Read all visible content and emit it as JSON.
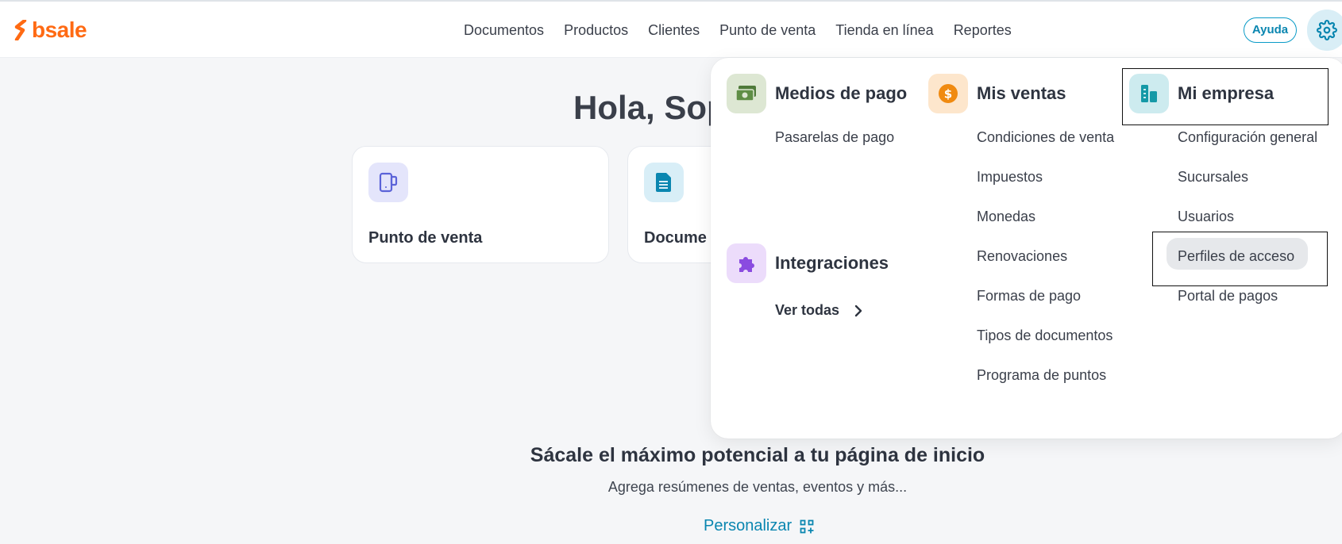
{
  "brand": {
    "name": "bsale",
    "color": "#ff6a13"
  },
  "nav": {
    "items": [
      "Documentos",
      "Productos",
      "Clientes",
      "Punto de venta",
      "Tienda en línea",
      "Reportes"
    ],
    "help_label": "Ayuda",
    "settings_icon": "gear-icon"
  },
  "home": {
    "greeting": "Hola, Sop",
    "cards": [
      {
        "title": "Punto de venta",
        "icon": "pos-device-icon"
      },
      {
        "title": "Docume",
        "icon": "document-icon"
      }
    ],
    "promo": {
      "title": "Sácale el máximo potencial a tu página de inicio",
      "subtitle": "Agrega resúmenes de ventas, eventos y más...",
      "link": "Personalizar",
      "link_icon": "customize-grid-icon"
    }
  },
  "settings_menu": {
    "payments": {
      "title": "Medios de pago",
      "icon": "money-icon",
      "items": [
        "Pasarelas de pago"
      ]
    },
    "integrations": {
      "title": "Integraciones",
      "icon": "puzzle-icon",
      "see_all": "Ver todas"
    },
    "sales": {
      "title": "Mis ventas",
      "icon": "dollar-coin-icon",
      "items": [
        "Condiciones de venta",
        "Impuestos",
        "Monedas",
        "Renovaciones",
        "Formas de pago",
        "Tipos de documentos",
        "Programa de puntos"
      ]
    },
    "company": {
      "title": "Mi empresa",
      "icon": "building-icon",
      "items": [
        "Configuración general",
        "Sucursales",
        "Usuarios",
        "Perfiles de acceso",
        "Portal de pagos"
      ],
      "hovered_item": "Perfiles de acceso"
    }
  },
  "colors": {
    "accent": "#0a86b0",
    "payments_icon_bg": "#dde7d3",
    "sales_icon_bg": "#fde6cc",
    "company_icon_bg": "#cdebef",
    "integrations_icon_bg": "#ecdcfb",
    "card_pos_icon_bg": "#e4e5fb",
    "card_doc_icon_bg": "#d8eef7"
  }
}
